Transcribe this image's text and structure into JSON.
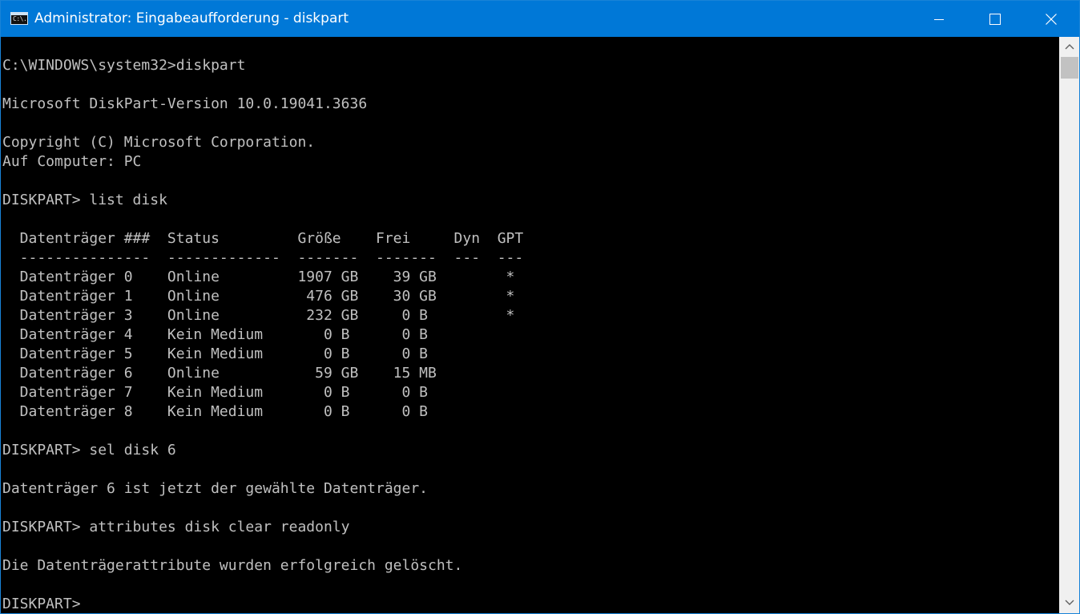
{
  "window": {
    "title": "Administrator: Eingabeaufforderung - diskpart",
    "icon": "cmd-icon",
    "icon_glyph": "C:\\.",
    "accent_color": "#0078d7",
    "controls": {
      "minimize": "minimize-icon",
      "maximize": "maximize-icon",
      "close": "close-icon"
    }
  },
  "console": {
    "text_color": "#c0c0c0",
    "background": "#000000",
    "lines": [
      "C:\\WINDOWS\\system32>diskpart",
      "",
      "Microsoft DiskPart-Version 10.0.19041.3636",
      "",
      "Copyright (C) Microsoft Corporation.",
      "Auf Computer: PC",
      "",
      "DISKPART> list disk",
      "",
      "  Datenträger ###  Status         Größe    Frei     Dyn  GPT",
      "  ---------------  -------------  -------  -------  ---  ---",
      "  Datenträger 0    Online         1907 GB    39 GB        *",
      "  Datenträger 1    Online          476 GB    30 GB        *",
      "  Datenträger 3    Online          232 GB     0 B         *",
      "  Datenträger 4    Kein Medium       0 B      0 B",
      "  Datenträger 5    Kein Medium       0 B      0 B",
      "  Datenträger 6    Online           59 GB    15 MB",
      "  Datenträger 7    Kein Medium       0 B      0 B",
      "  Datenträger 8    Kein Medium       0 B      0 B",
      "",
      "DISKPART> sel disk 6",
      "",
      "Datenträger 6 ist jetzt der gewählte Datenträger.",
      "",
      "DISKPART> attributes disk clear readonly",
      "",
      "Die Datenträgerattribute wurden erfolgreich gelöscht.",
      "",
      "DISKPART> "
    ]
  },
  "scrollbar": {
    "up": "scroll-up-arrow-icon",
    "down": "scroll-down-arrow-icon",
    "position_fraction": 0.0
  }
}
